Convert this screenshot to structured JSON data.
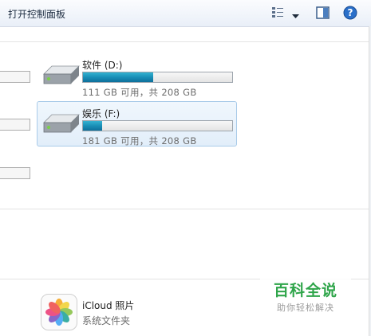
{
  "toolbar": {
    "open_control_panel": "打开控制面板",
    "icons": [
      "views-icon",
      "chevron-down-icon",
      "preview-pane-icon",
      "help-icon"
    ]
  },
  "drives": [
    {
      "name": "软件 (D:)",
      "size_text": "111 GB 可用，共 208 GB",
      "used_fraction": 0.47,
      "selected": false
    },
    {
      "name": "娱乐 (F:)",
      "size_text": "181 GB 可用，共 208 GB",
      "used_fraction": 0.13,
      "selected": true
    }
  ],
  "other_items": [
    {
      "name": "iCloud 照片",
      "type": "系统文件夹",
      "icon": "photos-icon"
    }
  ],
  "watermark": {
    "title": "百科全说",
    "subtitle": "助你轻松解决"
  },
  "colors": {
    "bar_fill": "#1a8fb7",
    "selection": "#e2eefa",
    "watermark_green": "#2fa54a"
  }
}
